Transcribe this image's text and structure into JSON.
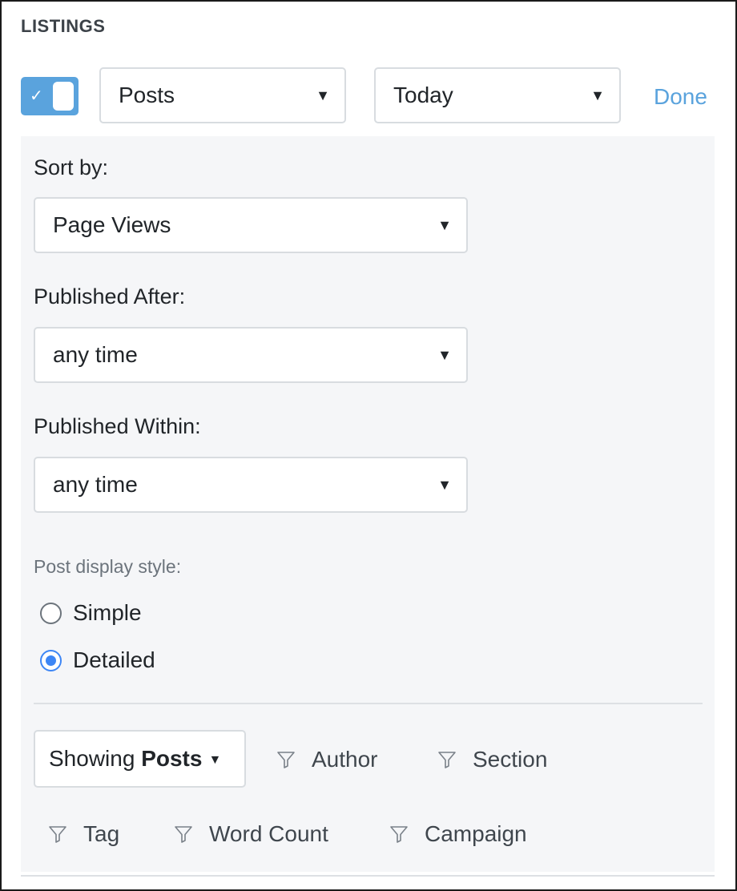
{
  "section": {
    "title": "LISTINGS"
  },
  "toggle": {
    "checked": true,
    "check_glyph": "✓"
  },
  "content_type_select": {
    "value": "Posts"
  },
  "date_range_select": {
    "value": "Today"
  },
  "done_link": {
    "label": "Done"
  },
  "sort_by": {
    "label": "Sort by:",
    "value": "Page Views"
  },
  "published_after": {
    "label": "Published After:",
    "value": "any time"
  },
  "published_within": {
    "label": "Published Within:",
    "value": "any time"
  },
  "display_style": {
    "label": "Post display style:",
    "options": [
      {
        "label": "Simple",
        "selected": false
      },
      {
        "label": "Detailed",
        "selected": true
      }
    ]
  },
  "showing": {
    "prefix": "Showing",
    "value": "Posts"
  },
  "filters": [
    "Author",
    "Section",
    "Tag",
    "Word Count",
    "Campaign"
  ],
  "icons": {
    "caret": "▼",
    "small_caret": "▼",
    "filter": "filter-icon"
  },
  "colors": {
    "accent": "#5aa3dd",
    "radio": "#3d86f5",
    "panel_bg": "#f5f6f8"
  }
}
